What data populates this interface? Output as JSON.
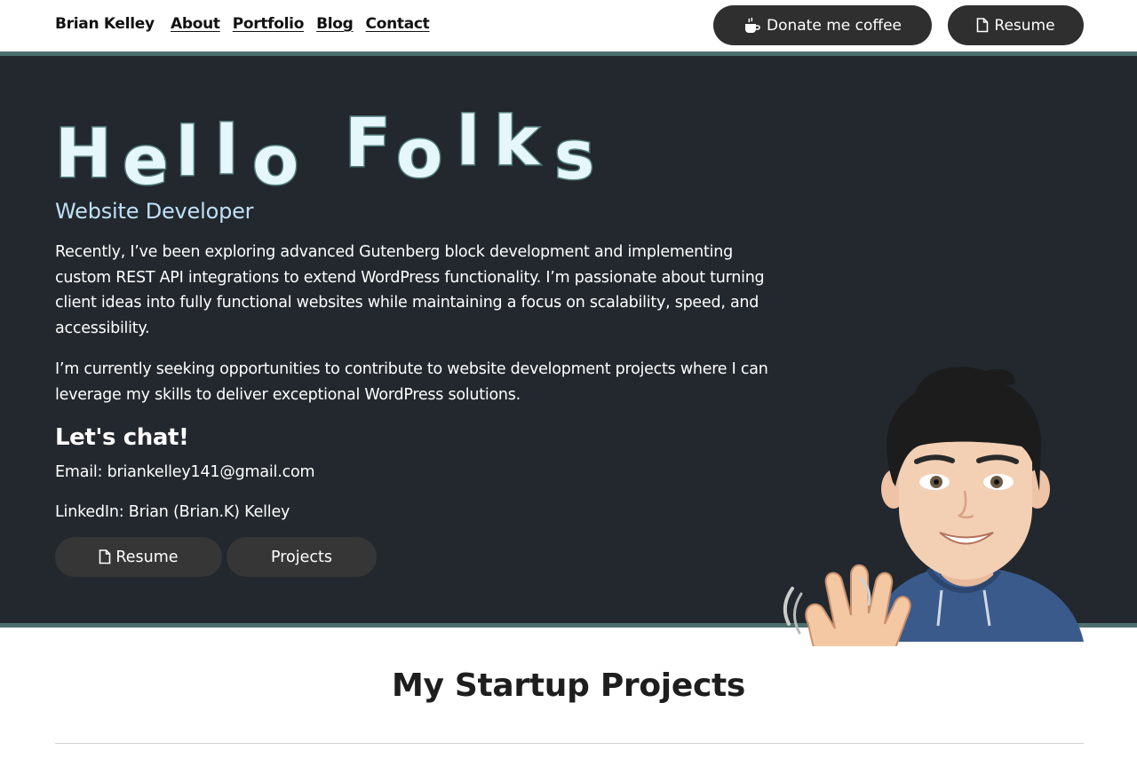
{
  "nav": {
    "brand": "Brian Kelley",
    "links": [
      "About",
      "Portfolio",
      "Blog",
      "Contact"
    ],
    "donate_label": "Donate me coffee",
    "resume_label": "Resume"
  },
  "hero": {
    "headline": [
      "H",
      "e",
      "l",
      "l",
      "o",
      "F",
      "o",
      "l",
      "k",
      "s"
    ],
    "subtitle": "Website Developer",
    "paragraph1": "Recently, I’ve been exploring advanced Gutenberg block development and implementing custom REST API integrations to extend WordPress functionality. I’m passionate about turning client ideas into fully functional websites while maintaining a focus on scalability, speed, and accessibility.",
    "paragraph2": "I’m currently seeking opportunities to contribute to website development projects where I can leverage my skills to deliver exceptional WordPress solutions.",
    "chat_heading": "Let's chat!",
    "email": "Email: briankelley141@gmail.com",
    "linkedin": "LinkedIn: Brian (Brian.K) Kelley",
    "resume_button": "Resume",
    "projects_button": "Projects"
  },
  "section": {
    "title": "My Startup Projects"
  },
  "icons": {
    "coffee": "coffee-cup-icon",
    "resume": "document-icon"
  },
  "colors": {
    "hero_bg": "#22282e",
    "accent_border": "#4d6e6e",
    "button_bg": "#2f2f2f",
    "subtitle": "#bfe0f5"
  }
}
